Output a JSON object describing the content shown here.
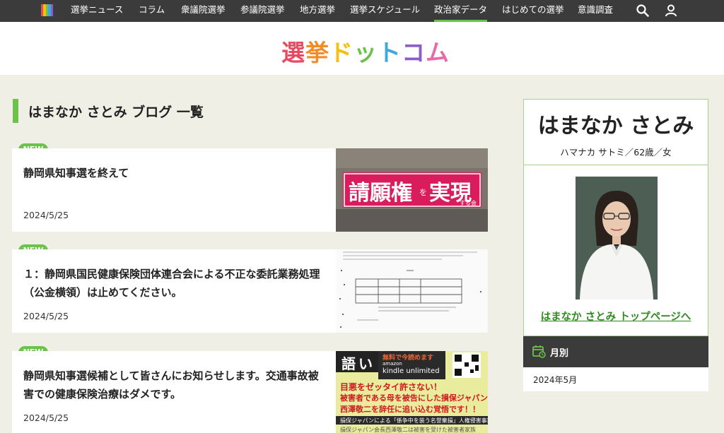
{
  "nav": {
    "items": [
      {
        "label": "選挙ニュース",
        "active": false
      },
      {
        "label": "コラム",
        "active": false
      },
      {
        "label": "衆議院選挙",
        "active": false
      },
      {
        "label": "参議院選挙",
        "active": false
      },
      {
        "label": "地方選挙",
        "active": false
      },
      {
        "label": "選挙スケジュール",
        "active": false
      },
      {
        "label": "政治家データ",
        "active": true
      },
      {
        "label": "はじめての選挙",
        "active": false
      },
      {
        "label": "意識調査",
        "active": false
      }
    ],
    "icons": [
      "search-icon",
      "user-icon"
    ]
  },
  "brand": {
    "chars": [
      {
        "c": "選",
        "color": "#e84a5f"
      },
      {
        "c": "挙",
        "color": "#f28c28"
      },
      {
        "c": "ド",
        "color": "#f4c20d"
      },
      {
        "c": "ッ",
        "color": "#6cc24a"
      },
      {
        "c": "ト",
        "color": "#3fa8e0"
      },
      {
        "c": "コ",
        "color": "#8e5cc9"
      },
      {
        "c": "ム",
        "color": "#e86aa8"
      }
    ]
  },
  "page": {
    "title": "はまなか さとみ ブログ 一覧"
  },
  "posts": [
    {
      "badge": "NEW",
      "title": "静岡県知事選を終えて",
      "date": "2024/5/25",
      "thumb_text": {
        "main": "請願権",
        "small": "を",
        "main2": "実現",
        "sub": "する会"
      }
    },
    {
      "badge": "NEW",
      "title": "１：静岡県国民健康保険団体連合会による不正な委託業務処理（公金横領）は止めてください。",
      "date": "2024/5/25"
    },
    {
      "badge": "NEW",
      "title": "静岡県知事選候補として皆さんにお知らせします。交通事故被害での健康保険治療はダメです。",
      "date": "2024/5/25",
      "thumb_text": {
        "free": "無料で今読めます",
        "amazon": "amazon",
        "kindle": "kindle unlimited",
        "line1": "目悪をゼッタイ許さない！",
        "line2": "被害者である母を被告にした損保ジャパン",
        "line3": "西澤敬二を辞任に追い込む覚悟です！！",
        "band": "損保ジャパンによる「係争中を装う名誉棄損」人権侵害事案",
        "bottom": "損保ジャパン会長西澤敬二は被害を受けた被害者家族",
        "corner": "い",
        "corner2": "語"
      }
    }
  ],
  "sidebar": {
    "name": "はまなか さとみ",
    "kana": "ハマナカ サトミ／62歳／女",
    "top_link": "はまなか さとみ トップページへ",
    "monthly_label": "月別",
    "month_value": "2024年5月"
  },
  "colors": {
    "accent": "#6cc24a",
    "dark": "#3b3b3b",
    "link": "#2f8a20"
  }
}
